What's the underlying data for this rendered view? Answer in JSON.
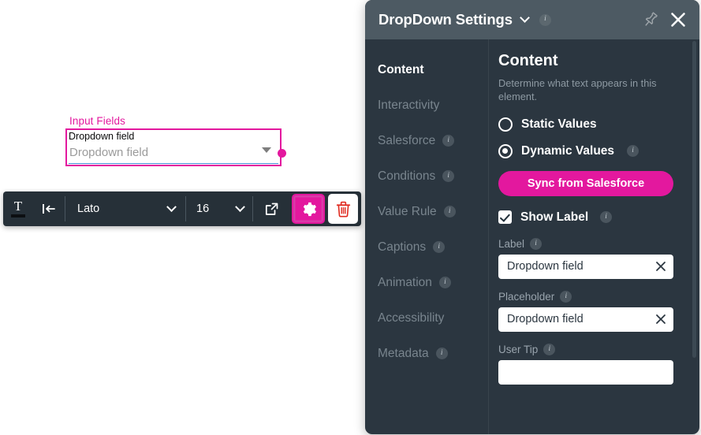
{
  "canvas": {
    "group_label": "Input Fields",
    "element": {
      "label": "Dropdown field",
      "placeholder": "Dropdown field",
      "chevron_icon": "chevron-down-icon",
      "selection_color": "#e3189e",
      "underline_color": "#4a90d9"
    }
  },
  "toolbar": {
    "text_color_icon": "text-color-icon",
    "align_icon": "align-left-icon",
    "font_family": "Lato",
    "font_size": "16",
    "open_external_icon": "open-external-icon",
    "settings_icon": "gear-icon",
    "delete_icon": "trash-icon",
    "active_button": "settings",
    "accent_color": "#e3189e"
  },
  "panel": {
    "header": {
      "title": "DropDown Settings",
      "chevron_icon": "chevron-down-icon",
      "info_icon": "info-icon",
      "pin_icon": "pin-icon",
      "close_icon": "close-icon"
    },
    "sidebar": {
      "items": [
        {
          "label": "Content",
          "active": true,
          "has_info": false
        },
        {
          "label": "Interactivity",
          "active": false,
          "has_info": false
        },
        {
          "label": "Salesforce",
          "active": false,
          "has_info": true
        },
        {
          "label": "Conditions",
          "active": false,
          "has_info": true
        },
        {
          "label": "Value Rule",
          "active": false,
          "has_info": true
        },
        {
          "label": "Captions",
          "active": false,
          "has_info": true
        },
        {
          "label": "Animation",
          "active": false,
          "has_info": true
        },
        {
          "label": "Accessibility",
          "active": false,
          "has_info": false
        },
        {
          "label": "Metadata",
          "active": false,
          "has_info": true
        }
      ]
    },
    "content": {
      "heading": "Content",
      "description": "Determine what text appears in this element.",
      "value_mode": {
        "options": [
          {
            "label": "Static Values",
            "selected": false,
            "has_info": false
          },
          {
            "label": "Dynamic Values",
            "selected": true,
            "has_info": true
          }
        ]
      },
      "sync_button": "Sync from Salesforce",
      "show_label": {
        "label": "Show Label",
        "checked": true
      },
      "fields": [
        {
          "label": "Label",
          "value": "Dropdown field",
          "placeholder": ""
        },
        {
          "label": "Placeholder",
          "value": "Dropdown field",
          "placeholder": ""
        },
        {
          "label": "User Tip",
          "value": "",
          "placeholder": ""
        }
      ]
    }
  }
}
